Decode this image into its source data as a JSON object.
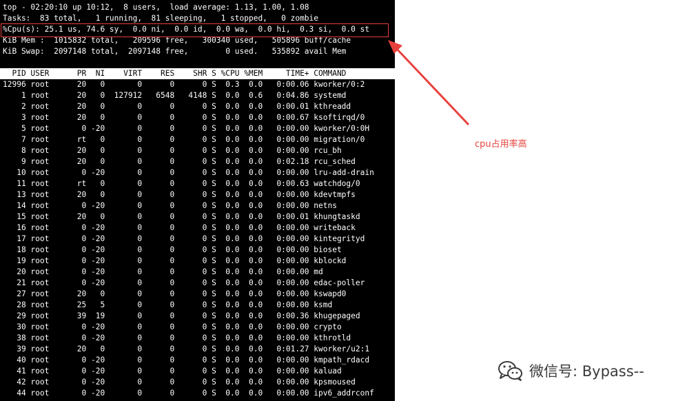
{
  "summary": [
    "top - 02:20:10 up 10:12,  8 users,  load average: 1.13, 1.00, 1.08",
    "Tasks:  83 total,   1 running,  81 sleeping,   1 stopped,   0 zombie",
    "%Cpu(s): 25.1 us, 74.6 sy,  0.0 ni,  0.0 id,  0.0 wa,  0.0 hi,  0.3 si,  0.0 st",
    "KiB Mem :  1015832 total,   209596 free,   300340 used,   505896 buff/cache",
    "KiB Swap:  2097148 total,  2097148 free,        0 used.   535892 avail Mem"
  ],
  "table_header": "  PID USER      PR  NI    VIRT    RES    SHR S %CPU %MEM     TIME+ COMMAND",
  "processes": [
    "12996 root      20   0       0      0      0 S  0.3  0.0   0:00.06 kworker/0:2",
    "    1 root      20   0  127912   6548   4148 S  0.0  0.6   0:04.86 systemd",
    "    2 root      20   0       0      0      0 S  0.0  0.0   0:00.01 kthreadd",
    "    3 root      20   0       0      0      0 S  0.0  0.0   0:00.67 ksoftirqd/0",
    "    5 root       0 -20       0      0      0 S  0.0  0.0   0:00.00 kworker/0:0H",
    "    7 root      rt   0       0      0      0 S  0.0  0.0   0:00.00 migration/0",
    "    8 root      20   0       0      0      0 S  0.0  0.0   0:00.00 rcu_bh",
    "    9 root      20   0       0      0      0 S  0.0  0.0   0:02.18 rcu_sched",
    "   10 root       0 -20       0      0      0 S  0.0  0.0   0:00.00 lru-add-drain",
    "   11 root      rt   0       0      0      0 S  0.0  0.0   0:00.63 watchdog/0",
    "   13 root      20   0       0      0      0 S  0.0  0.0   0:00.00 kdevtmpfs",
    "   14 root       0 -20       0      0      0 S  0.0  0.0   0:00.00 netns",
    "   15 root      20   0       0      0      0 S  0.0  0.0   0:00.01 khungtaskd",
    "   16 root       0 -20       0      0      0 S  0.0  0.0   0:00.00 writeback",
    "   17 root       0 -20       0      0      0 S  0.0  0.0   0:00.00 kintegrityd",
    "   18 root       0 -20       0      0      0 S  0.0  0.0   0:00.00 bioset",
    "   19 root       0 -20       0      0      0 S  0.0  0.0   0:00.00 kblockd",
    "   20 root       0 -20       0      0      0 S  0.0  0.0   0:00.00 md",
    "   21 root       0 -20       0      0      0 S  0.0  0.0   0:00.00 edac-poller",
    "   27 root      20   0       0      0      0 S  0.0  0.0   0:00.00 kswapd0",
    "   28 root      25   5       0      0      0 S  0.0  0.0   0:00.00 ksmd",
    "   29 root      39  19       0      0      0 S  0.0  0.0   0:00.36 khugepaged",
    "   30 root       0 -20       0      0      0 S  0.0  0.0   0:00.00 crypto",
    "   38 root       0 -20       0      0      0 S  0.0  0.0   0:00.00 kthrotld",
    "   39 root      20   0       0      0      0 S  0.0  0.0   0:01.27 kworker/u2:1",
    "   40 root       0 -20       0      0      0 S  0.0  0.0   0:00.00 kmpath_rdacd",
    "   41 root       0 -20       0      0      0 S  0.0  0.0   0:00.00 kaluad",
    "   42 root       0 -20       0      0      0 S  0.0  0.0   0:00.00 kpsmoused",
    "   44 root       0 -20       0      0      0 S  0.0  0.0   0:00.00 ipv6_addrconf"
  ],
  "annotation": {
    "label": "cpu占用率高",
    "color": "#e8413c"
  },
  "watermark": {
    "text": "微信号: Bypass--",
    "icon": "wechat-icon"
  }
}
